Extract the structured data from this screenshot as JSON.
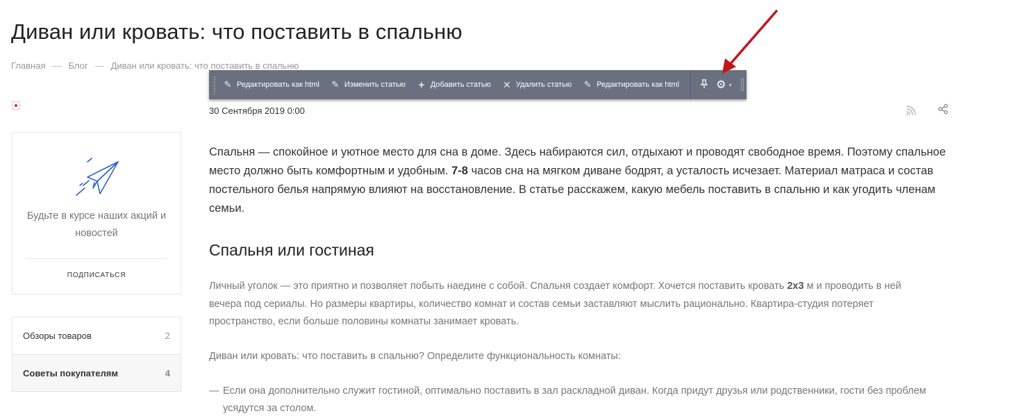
{
  "page": {
    "title": "Диван или кровать: что поставить в спальню"
  },
  "breadcrumb": {
    "items": [
      "Главная",
      "Блог",
      "Диван или кровать: что поставить в спальню"
    ],
    "separator": "—"
  },
  "toolbar": {
    "buttons": [
      {
        "label": "Редактировать как html",
        "icon": "pencil-icon"
      },
      {
        "label": "Изменить статью",
        "icon": "pencil-icon"
      },
      {
        "label": "Добавить статью",
        "icon": "plus-icon"
      },
      {
        "label": "Удалить статью",
        "icon": "close-icon"
      },
      {
        "label": "Редактировать как html",
        "icon": "pencil-icon"
      }
    ],
    "pin_icon": "pin-icon",
    "gear_icon": "gear-icon",
    "background": "#6b7080"
  },
  "sidebar": {
    "subscribe": {
      "text": "Будьте в курсе наших акций и новостей",
      "button": "ПОДПИСАТЬСЯ",
      "icon": "paper-plane-icon",
      "icon_color": "#2e62c9"
    },
    "categories": [
      {
        "label": "Обзоры товаров",
        "count": "2",
        "active": false
      },
      {
        "label": "Советы покупателям",
        "count": "4",
        "active": true
      }
    ]
  },
  "post": {
    "date": "30 Сентября 2019 0:00",
    "intro_part1": "Спальня — спокойное и уютное место для сна в доме. Здесь набираются сил, отдыхают и проводят свободное время. Поэтому спальное место должно быть комфортным и удобным. ",
    "intro_bold": "7-8",
    "intro_part2": " часов сна на мягком диване бодрят, а усталость исчезает. Материал матраса и состав постельного белья напрямую влияют на восстановление. В статье расскажем, какую мебель поставить в спальню и как угодить членам семьи.",
    "section_heading": "Спальня или гостиная",
    "para1_part1": "Личный уголок — это приятно и позволяет побыть наедине с собой. Спальня создает комфорт. Хочется поставить кровать ",
    "para1_bold": "2х3",
    "para1_part2": " м и проводить в ней вечера под сериалы. Но размеры квартиры, количество комнат и состав семьи заставляют мыслить рационально. Квартира-студия потеряет пространство, если больше половины комнаты занимает кровать.",
    "para2": "Диван или кровать: что поставить в спальню? Определите функциональность комнаты:",
    "list": [
      "Если она дополнительно служит гостиной, оптимально поставить в зал раскладной диван. Когда придут друзья или родственники, гости без проблем усядутся за столом."
    ],
    "list_dash": "—"
  },
  "annotation": {
    "arrow_color": "#c0161c"
  }
}
